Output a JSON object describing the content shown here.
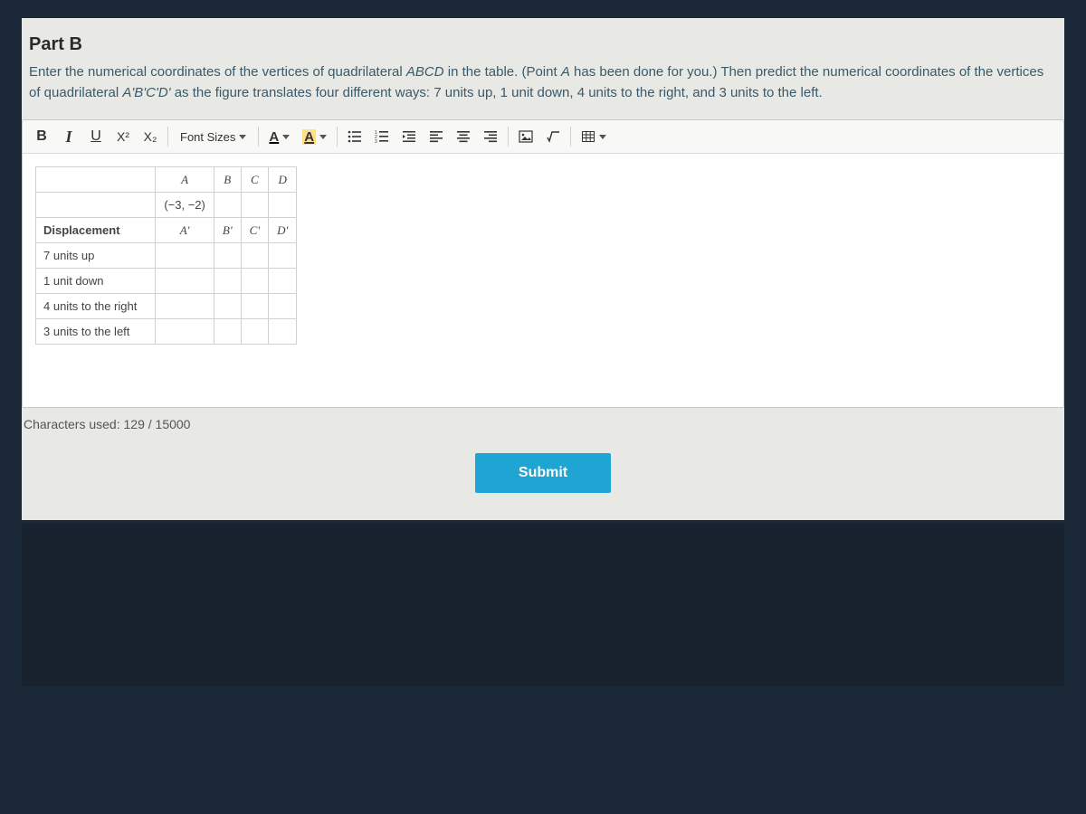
{
  "part": {
    "title": "Part B",
    "instruction_html": "Enter the numerical coordinates of the vertices of quadrilateral ABCD in the table. (Point A has been done for you.) Then predict the numerical coordinates of the vertices of quadrilateral A'B'C'D' as the figure translates four different ways: 7 units up, 1 unit down, 4 units to the right, and 3 units to the left."
  },
  "toolbar": {
    "bold": "B",
    "italic": "I",
    "underline": "U",
    "superscript": "X²",
    "subscript": "X₂",
    "font_sizes": "Font Sizes"
  },
  "table": {
    "headers_top": [
      "A",
      "B",
      "C",
      "D"
    ],
    "row_given": [
      "(−3, −2)",
      "",
      "",
      ""
    ],
    "displacement_label": "Displacement",
    "headers_prime": [
      "A'",
      "B'",
      "C'",
      "D'"
    ],
    "rows": [
      {
        "label": "7 units up",
        "cells": [
          "",
          "",
          "",
          ""
        ]
      },
      {
        "label": "1 unit down",
        "cells": [
          "",
          "",
          "",
          ""
        ]
      },
      {
        "label": "4 units to the right",
        "cells": [
          "",
          "",
          "",
          ""
        ]
      },
      {
        "label": "3 units to the left",
        "cells": [
          "",
          "",
          "",
          ""
        ]
      }
    ]
  },
  "char_counter": {
    "label": "Characters used: ",
    "used": 129,
    "max": 15000
  },
  "submit_label": "Submit"
}
